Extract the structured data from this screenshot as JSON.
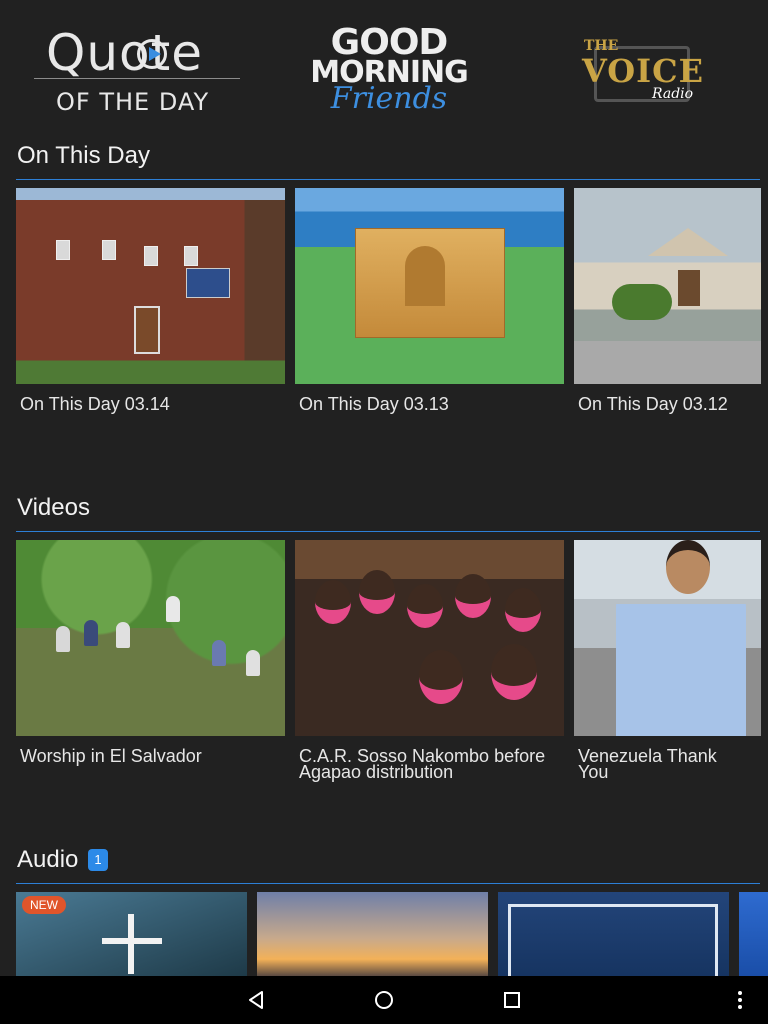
{
  "logos": {
    "quote": {
      "line1": "Quote",
      "line2": "OF THE DAY"
    },
    "good_morning": {
      "line1": "GOOD",
      "line2": "MORNING",
      "line3": "Friends"
    },
    "voice": {
      "the": "THE",
      "voice": "VOICE",
      "radio": "Radio"
    }
  },
  "sections": {
    "on_this_day": {
      "title": "On This Day",
      "items": [
        {
          "label": "On This Day 03.14"
        },
        {
          "label": "On This Day 03.13"
        },
        {
          "label": "On This Day 03.12"
        }
      ]
    },
    "videos": {
      "title": "Videos",
      "items": [
        {
          "label": "Worship in El Salvador"
        },
        {
          "label": "C.A.R. Sosso Nakombo before Agapao distribution"
        },
        {
          "label": "Venezuela Thank You"
        }
      ]
    },
    "audio": {
      "title": "Audio",
      "badge": "1",
      "items": [
        {
          "badge": "NEW"
        },
        {},
        {},
        {}
      ]
    }
  },
  "colors": {
    "background": "#212121",
    "accent": "#2d7fd6",
    "badge": "#2c8ae8",
    "new_badge": "#e0552b",
    "voice_gold": "#c9a445",
    "friends_blue": "#3d8fe0"
  },
  "navbar": {
    "icons": [
      "back-icon",
      "home-icon",
      "recents-icon",
      "overflow-menu-icon"
    ]
  }
}
